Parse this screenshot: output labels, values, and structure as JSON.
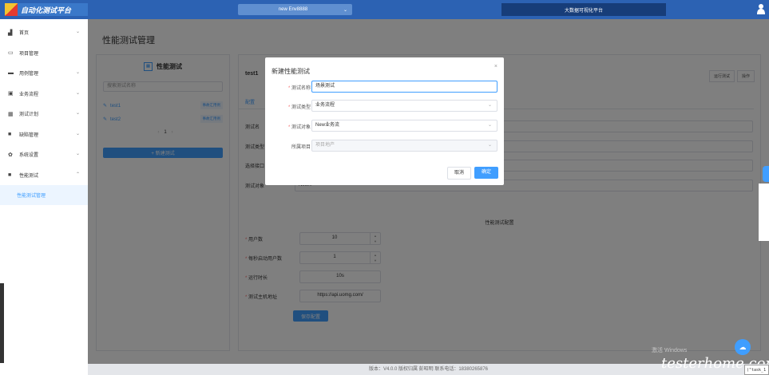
{
  "topbar": {
    "logo_text": "自动化测试平台",
    "env_label": "new Env8888",
    "env_chevron": "⌄",
    "bigscreen_label": "大数据可视化平台"
  },
  "sidebar": {
    "items": [
      {
        "label": "首页",
        "icon": "bar-chart-icon"
      },
      {
        "label": "项目管理",
        "icon": "window-icon"
      },
      {
        "label": "用例管理",
        "icon": "briefcase-icon"
      },
      {
        "label": "业务流程",
        "icon": "suitcase-icon"
      },
      {
        "label": "测试计划",
        "icon": "calendar-icon"
      },
      {
        "label": "缺陷管理",
        "icon": "bug-icon"
      },
      {
        "label": "系统设置",
        "icon": "gear-icon"
      },
      {
        "label": "性能测试",
        "icon": "chart-icon"
      }
    ],
    "active_sub": "性能测试管理"
  },
  "page": {
    "title": "性能测试管理"
  },
  "left_panel": {
    "header": "性能测试",
    "search_placeholder": "搜索测试名称",
    "items": [
      {
        "name": "test1",
        "tag": "事故汇用例"
      },
      {
        "name": "test2",
        "tag": "事故汇用例"
      }
    ],
    "pager": {
      "prev": "‹",
      "page": "1",
      "next": "›"
    },
    "new_button": "+ 新建测试"
  },
  "right_panel": {
    "test_name": "test1",
    "buttons": [
      "运行测试",
      "操作"
    ],
    "tab": "配置",
    "rows": [
      {
        "label": "测试名",
        "value": ""
      },
      {
        "label": "测试类型",
        "value": ""
      },
      {
        "label": "选择接口",
        "value": ""
      },
      {
        "label": "测试对象",
        "value": "New..."
      }
    ],
    "perf_section_title": "性能测试配置",
    "perf": [
      {
        "label": "用户数",
        "value": "10"
      },
      {
        "label": "每秒启动用户数",
        "value": "1"
      },
      {
        "label": "运行时长",
        "value": "10s"
      },
      {
        "label": "测试主机地址",
        "value": "https://api.uomg.com/"
      }
    ],
    "save_button": "保存配置"
  },
  "footer": "版本：V4.0.0   版权归属 彭昭明   联系电话：18380265876",
  "modal": {
    "title": "新建性能测试",
    "close": "×",
    "fields": [
      {
        "label": "测试名称",
        "value": "场景测试",
        "required": "*"
      },
      {
        "label": "测试类型",
        "value": "业务流程",
        "required": "*"
      },
      {
        "label": "测试对象",
        "value": "New业务流",
        "required": "*"
      },
      {
        "label": "所属项目",
        "value": "项目地产",
        "required": ""
      }
    ],
    "cancel": "取消",
    "ok": "确定"
  },
  "overlay": {
    "watermark": "激活 Windows",
    "brand": "testerhome.com",
    "task_label": "(\"task_1"
  }
}
